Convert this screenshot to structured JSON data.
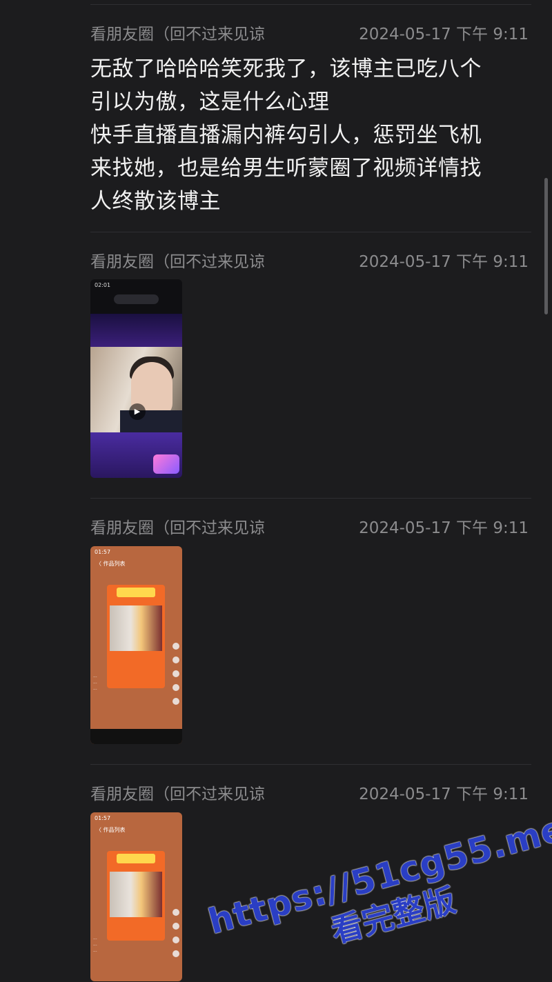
{
  "messages": [
    {
      "sender": "看朋友圈（回不过来见谅",
      "time": "2024-05-17 下午 9:11",
      "lines": [
        "无敌了哈哈哈笑死我了，该博主已吃八个",
        "引以为傲，这是什么心理",
        "快手直播直播漏内裤勾引人，惩罚坐飞机",
        "来找她，也是给男生听蒙圈了视频详情找",
        "人终散该博主"
      ]
    },
    {
      "sender": "看朋友圈（回不过来见谅",
      "time": "2024-05-17 下午 9:11",
      "media": "video-screenshot"
    },
    {
      "sender": "看朋友圈（回不过来见谅",
      "time": "2024-05-17 下午 9:11",
      "media": "image-screenshot"
    },
    {
      "sender": "看朋友圈（回不过来见谅",
      "time": "2024-05-17 下午 9:11",
      "media": "image-screenshot"
    }
  ],
  "thumbs": {
    "t1": {
      "status_time": "02:01",
      "play_icon": "▶"
    },
    "t2": {
      "status_time": "01:57",
      "header": "〈 作品列表"
    },
    "t3": {
      "status_time": "01:57",
      "header": "〈 作品列表"
    }
  },
  "watermark": {
    "line1": "https://51cg55.me",
    "line2": "看完整版",
    "color": "#2a3ec4"
  }
}
